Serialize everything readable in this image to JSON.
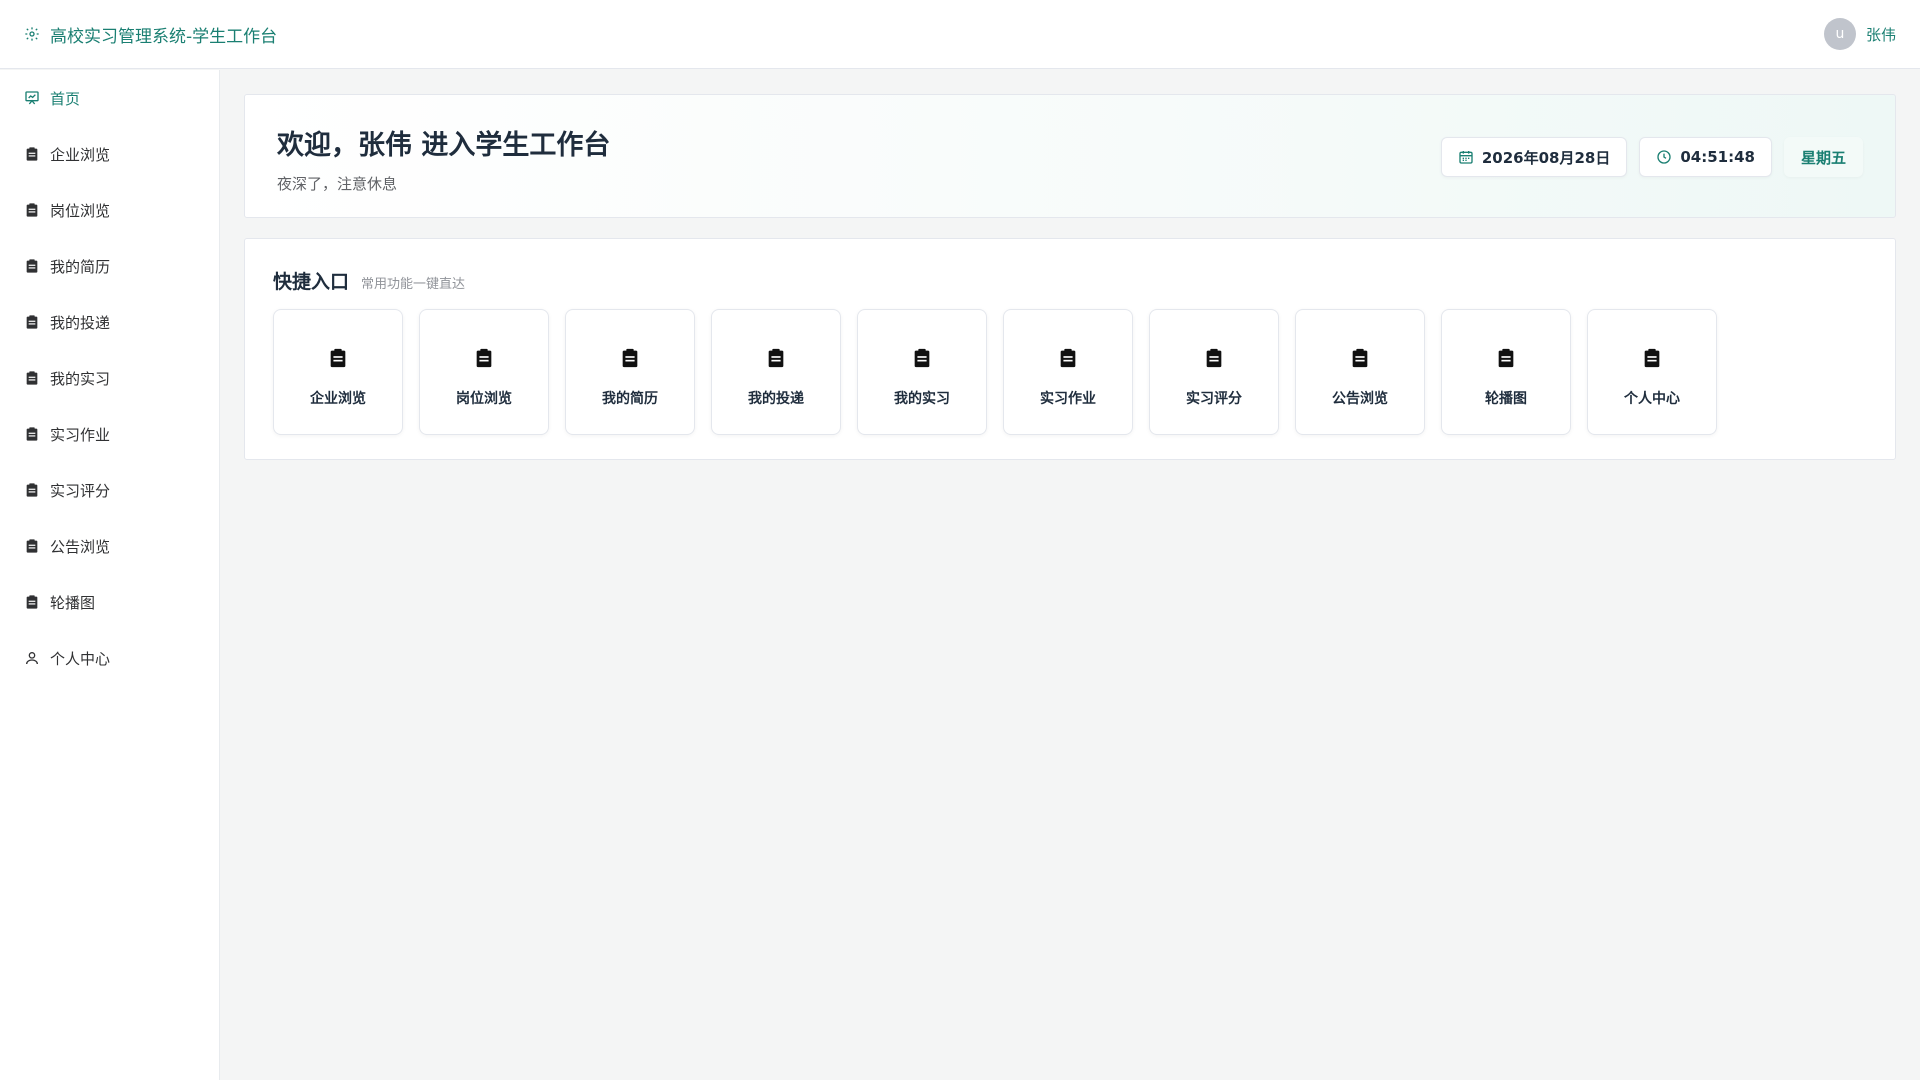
{
  "header": {
    "app_title": "高校实习管理系统-学生工作台",
    "brand_icon": "gear-icon",
    "avatar_letter": "u",
    "username": "张伟"
  },
  "colors": {
    "accent": "#1a7f72",
    "text": "#1f2d3d",
    "muted": "#909399",
    "background": "#f4f5f5"
  },
  "sidebar": {
    "items": [
      {
        "label": "首页",
        "icon": "chart-board-icon",
        "active": true
      },
      {
        "label": "企业浏览",
        "icon": "clipboard-icon"
      },
      {
        "label": "岗位浏览",
        "icon": "clipboard-icon"
      },
      {
        "label": "我的简历",
        "icon": "clipboard-icon"
      },
      {
        "label": "我的投递",
        "icon": "clipboard-icon"
      },
      {
        "label": "我的实习",
        "icon": "clipboard-icon"
      },
      {
        "label": "实习作业",
        "icon": "clipboard-icon"
      },
      {
        "label": "实习评分",
        "icon": "clipboard-icon"
      },
      {
        "label": "公告浏览",
        "icon": "clipboard-icon"
      },
      {
        "label": "轮播图",
        "icon": "clipboard-icon"
      },
      {
        "label": "个人中心",
        "icon": "user-icon"
      }
    ]
  },
  "welcome": {
    "heading": "欢迎，张伟 进入学生工作台",
    "subtitle": "夜深了，注意休息",
    "date": "2026年08月28日",
    "time": "04:51:48",
    "weekday": "星期五"
  },
  "quick": {
    "title": "快捷入口",
    "subtitle": "常用功能一键直达",
    "cards": [
      {
        "label": "企业浏览",
        "icon": "clipboard-icon"
      },
      {
        "label": "岗位浏览",
        "icon": "clipboard-icon"
      },
      {
        "label": "我的简历",
        "icon": "clipboard-icon"
      },
      {
        "label": "我的投递",
        "icon": "clipboard-icon"
      },
      {
        "label": "我的实习",
        "icon": "clipboard-icon"
      },
      {
        "label": "实习作业",
        "icon": "clipboard-icon"
      },
      {
        "label": "实习评分",
        "icon": "clipboard-icon"
      },
      {
        "label": "公告浏览",
        "icon": "clipboard-icon"
      },
      {
        "label": "轮播图",
        "icon": "clipboard-icon"
      },
      {
        "label": "个人中心",
        "icon": "clipboard-icon"
      }
    ]
  }
}
